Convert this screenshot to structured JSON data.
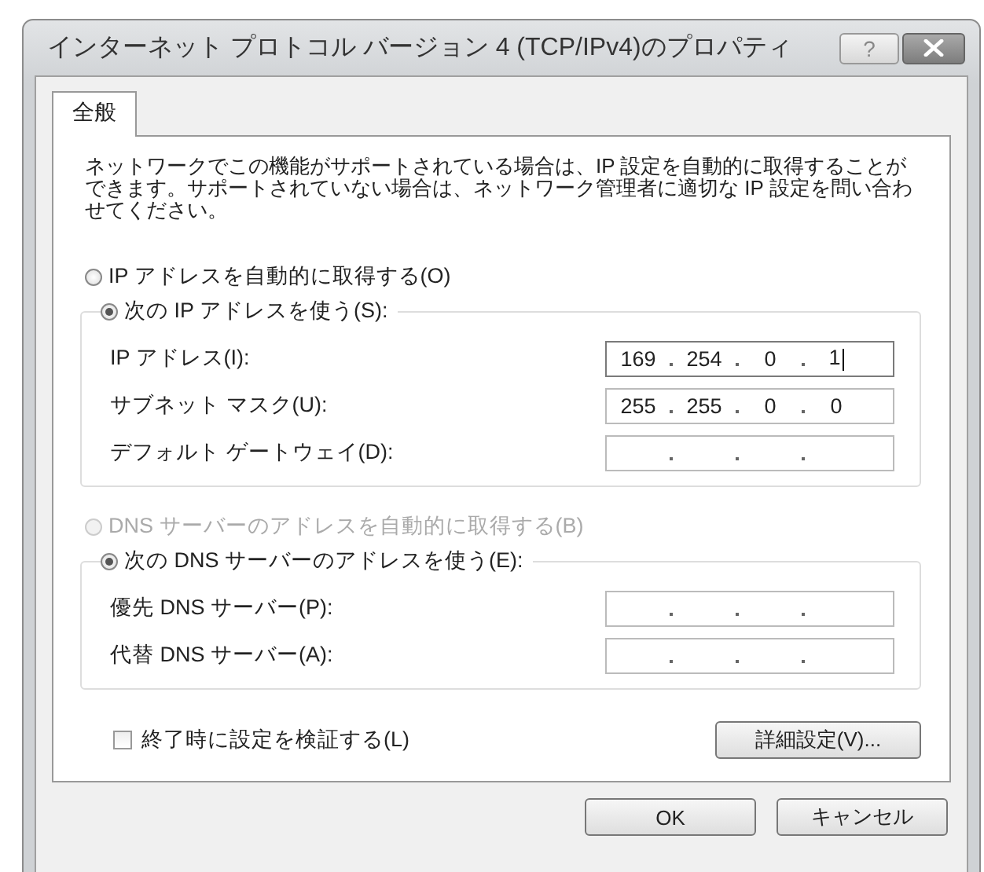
{
  "window": {
    "title": "インターネット プロトコル バージョン 4 (TCP/IPv4)のプロパティ",
    "help_button": "?"
  },
  "tabs": [
    {
      "label": "全般",
      "selected": true
    }
  ],
  "description": "ネットワークでこの機能がサポートされている場合は、IP 設定を自動的に取得することができます。サポートされていない場合は、ネットワーク管理者に適切な IP 設定を問い合わせてください。",
  "ip": {
    "options": [
      {
        "label": "IP アドレスを自動的に取得する(O)",
        "selected": false,
        "disabled": false
      },
      {
        "label": "次の IP アドレスを使う(S):",
        "selected": true,
        "disabled": false
      }
    ],
    "fields": [
      {
        "label": "IP アドレス(I):",
        "octets": [
          "169",
          "254",
          "0",
          "1"
        ],
        "focused": true
      },
      {
        "label": "サブネット マスク(U):",
        "octets": [
          "255",
          "255",
          "0",
          "0"
        ],
        "focused": false
      },
      {
        "label": "デフォルト ゲートウェイ(D):",
        "focused": false
      }
    ]
  },
  "dns": {
    "options": [
      {
        "label": "DNS サーバーのアドレスを自動的に取得する(B)",
        "selected": false,
        "disabled": true
      },
      {
        "label": "次の DNS サーバーのアドレスを使う(E):",
        "selected": true,
        "disabled": false
      }
    ],
    "fields": [
      {
        "label": "優先 DNS サーバー(P):",
        "focused": false
      },
      {
        "label": "代替 DNS サーバー(A):",
        "focused": false
      }
    ]
  },
  "validate_checkbox": {
    "label": "終了時に設定を検証する(L)",
    "checked": false
  },
  "advanced_button": "詳細設定(V)...",
  "buttons": [
    "OK",
    "キャンセル"
  ]
}
